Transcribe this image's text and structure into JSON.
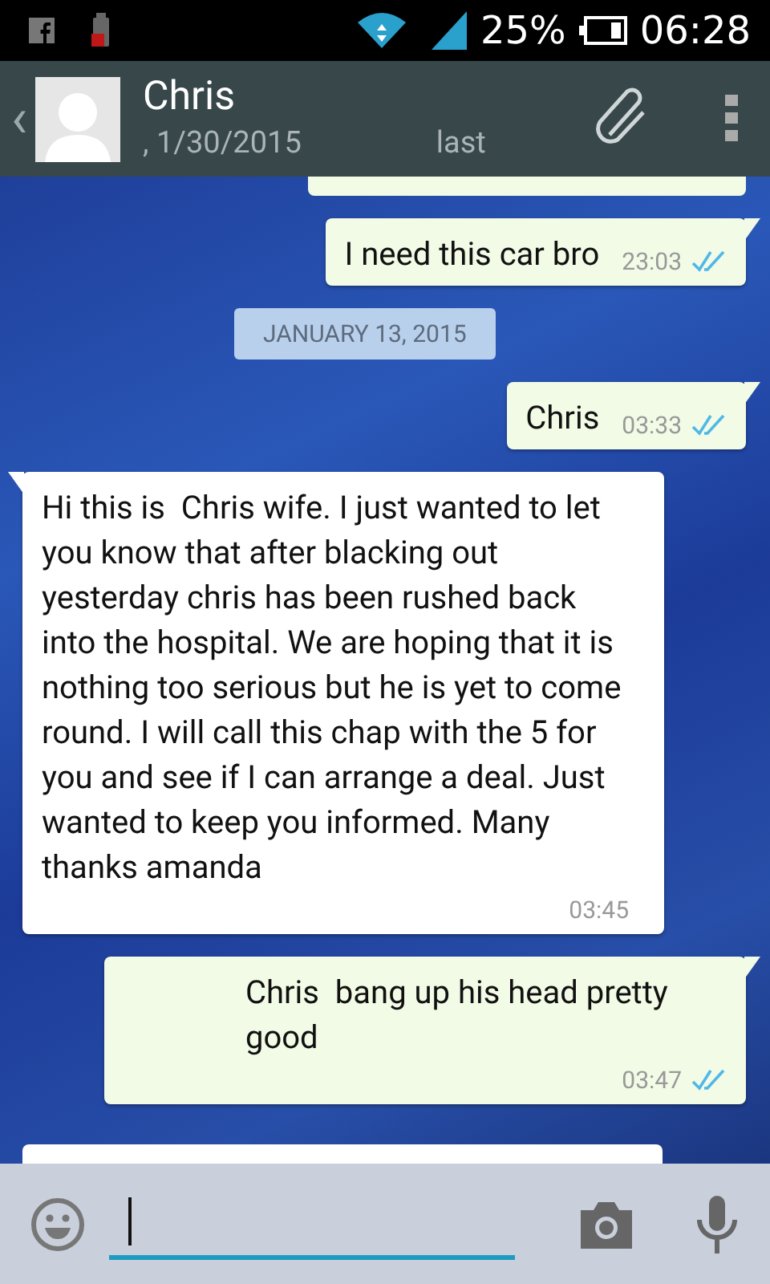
{
  "status_bar": {
    "battery_percent": "25%",
    "time": "06:28"
  },
  "header": {
    "back": "‹",
    "name": "Chris",
    "subtitle": ", 1/30/2015",
    "subtitle_2": "last"
  },
  "messages": [
    {
      "kind": "outgoing",
      "text": "I need this car bro",
      "time": "23:03",
      "read": true
    },
    {
      "kind": "date",
      "text": "JANUARY 13, 2015"
    },
    {
      "kind": "outgoing",
      "text": "Chris",
      "time": "03:33",
      "read": true
    },
    {
      "kind": "incoming",
      "text": "Hi this is  Chris wife. I just wanted to let you know that after blacking out yesterday chris has been rushed back into the hospital. We are hoping that it is nothing too serious but he is yet to come round. I will call this chap with the 5 for you and see if I can arrange a deal. Just wanted to keep you informed. Many thanks amanda",
      "time": "03:45"
    },
    {
      "kind": "outgoing",
      "text": "Chris  bang up his head pretty good",
      "time": "03:47",
      "read": true
    }
  ]
}
